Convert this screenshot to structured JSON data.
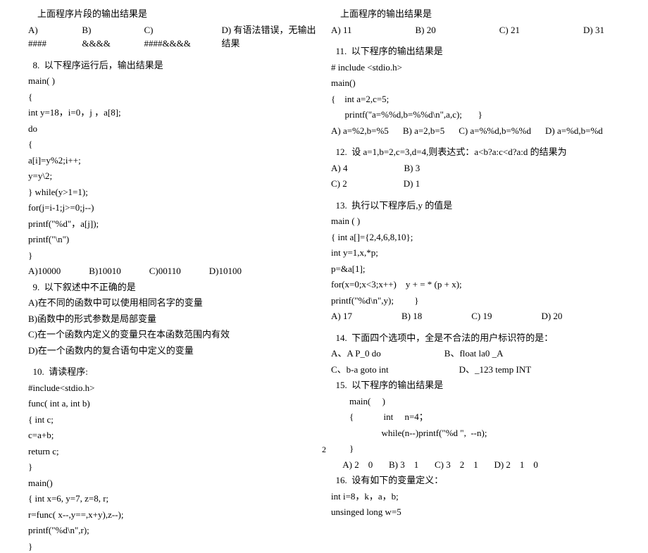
{
  "pageNum": "2",
  "left": {
    "intro": "上面程序片段的输出结果是",
    "opts1": [
      "A) ####",
      "B) &&&&",
      "C) ####&&&&",
      "D)  有语法错误，无输出结果"
    ],
    "q8": "  8.  以下程序运行后，输出结果是",
    "c8": [
      "main( )",
      "{",
      "int y=18，i=0，j ，a[8];",
      "do",
      "{",
      "a[i]=y%2;i++;",
      "y=y\\2;",
      "} while(y>1=1);",
      "for(j=i-1;j>=0;j--)",
      "printf(\"%d\"，a[j]);",
      "printf(\"\\n\")",
      "}"
    ],
    "opts8": [
      "A)10000",
      "B)10010",
      "C)00110",
      "D)10100"
    ],
    "q9": "  9.  以下叙述中不正确的是",
    "a9": [
      "A)在不同的函数中可以使用相同名字的变量",
      "B)函数中的形式参数是局部变量",
      "C)在一个函数内定义的变量只在本函数范围内有效",
      "D)在一个函数内的复合语句中定义的变量"
    ],
    "q10": "  10.  请读程序:",
    "c10": [
      "#include<stdio.h>",
      "func( int a, int b)",
      "{ int c;",
      "c=a+b;",
      "return c;",
      "}",
      "main()",
      "{ int x=6, y=7, z=8, r;",
      "r=func( x--,y==,x+y),z--);",
      "printf(\"%d\\n\",r);",
      "}"
    ]
  },
  "right": {
    "intro": "上面程序的输出结果是",
    "opts10": [
      "A) 11",
      "B) 20",
      "C) 21",
      "D) 31"
    ],
    "q11": "  11.  以下程序的输出结果是",
    "c11": [
      "# include <stdio.h>",
      "main()",
      "{    int a=2,c=5;",
      "      printf(\"a=%%d,b=%%d\\n\",a,c);       }"
    ],
    "opts11": [
      "A)  a=%2,b=%5",
      "B)  a=2,b=5",
      "C)  a=%%d,b=%%d",
      "D)  a=%d,b=%d"
    ],
    "q12": "  12.  设 a=1,b=2,c=3,d=4,则表达式：a<b?a:c<d?a:d 的结果为",
    "opts12a": [
      "A) 4",
      "B) 3"
    ],
    "opts12b": [
      "C) 2",
      "D) 1"
    ],
    "q13": "  13.  执行以下程序后,y 的值是",
    "c13": [
      "main ( )",
      "{ int a[]={2,4,6,8,10};",
      "int y=1,x,*p;",
      "p=&a[1];",
      "for(x=0;x<3;x++)    y + = * (p + x);",
      "printf(\"%d\\n\",y);         }"
    ],
    "opts13": [
      "A) 17",
      "B) 18",
      "C) 19",
      "D) 20"
    ],
    "q14": "  14.  下面四个选项中，全是不合法的用户标识符的是：",
    "opts14a": [
      "A、A    P_0 do",
      "B、float la0  _A"
    ],
    "opts14b": [
      "C、b-a goto int",
      "D、_123 temp INT"
    ],
    "q15": "  15.  以下程序的输出结果是",
    "c15": [
      "        main(     )",
      "        {             int     n=4；",
      "                      while(n--)printf(\"%d \",  --n);",
      "        }"
    ],
    "opts15": "     A) 2    0       B) 3    1       C) 3    2    1       D) 2    1    0",
    "q16": "  16.  设有如下的变量定义：",
    "c16": [
      "int i=8，k，a，b;",
      "unsinged long w=5"
    ]
  }
}
